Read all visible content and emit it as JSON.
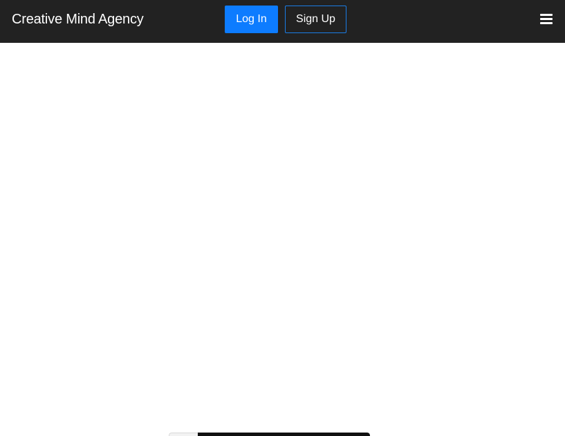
{
  "navbar": {
    "brand": "Creative Mind Agency",
    "login_label": "Log In",
    "signup_label": "Sign Up",
    "menu_icon": "hamburger-menu-icon"
  },
  "colors": {
    "navbar_bg": "#222222",
    "primary": "#0d7cff",
    "text_on_dark": "#ffffff",
    "page_bg": "#ffffff"
  }
}
